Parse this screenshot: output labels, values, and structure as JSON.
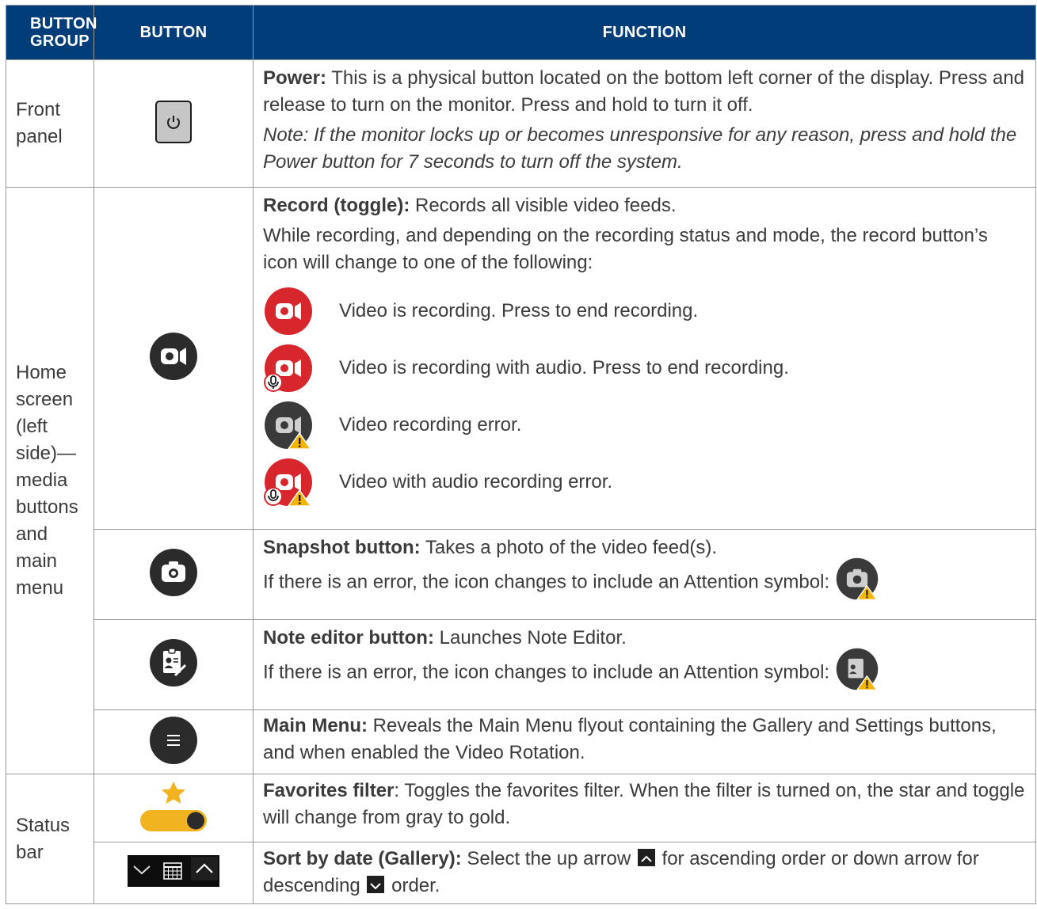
{
  "header": {
    "col1": "BUTTON GROUP",
    "col2": "BUTTON",
    "col3": "FUNCTION"
  },
  "rows": {
    "front_panel": {
      "group": "Front panel",
      "power_title": "Power:",
      "power_text": " This is a physical button located on the bottom left corner of the display. Press and release to turn on the monitor. Press and hold to turn it off.",
      "note": "Note: If the monitor locks up or becomes unresponsive for any reason, press and hold the Power button for 7 seconds to turn off the system."
    },
    "home_screen": {
      "group": "Home screen (left side)—media buttons and main menu",
      "record_title": "Record (toggle):",
      "record_text": " Records all visible video feeds.",
      "record_desc": "While recording, and depending on the recording status and mode, the record button’s icon will change to one of the following:",
      "states": [
        "Video is recording. Press to end recording.",
        "Video is recording with audio. Press to end recording.",
        "Video recording error.",
        "Video with audio recording error."
      ],
      "snapshot_title": "Snapshot button:",
      "snapshot_text": " Takes a photo of the video feed(s).",
      "snapshot_error": "If there is an error, the icon changes to include an Attention symbol:",
      "note_title": "Note editor button:",
      "note_text": " Launches Note Editor.",
      "note_error": "If there is an error, the icon changes to include an Attention symbol:",
      "menu_title": "Main Menu:",
      "menu_text": " Reveals the Main Menu flyout containing the Gallery and Settings buttons, and when enabled the Video Rotation."
    },
    "status_bar": {
      "group": "Status bar",
      "fav_title": "Favorites filter",
      "fav_text": ": Toggles the favorites filter. When the filter is turned on, the star and toggle will change from gray to gold.",
      "sort_title": "Sort by date (Gallery):",
      "sort_text1": " Select the up arrow ",
      "sort_text2": " for ascending order or down arrow for descending ",
      "sort_text3": " order."
    }
  },
  "colors": {
    "header_bg": "#003d79",
    "record_red": "#d8262d",
    "dark_icon": "#2b2b2b",
    "gold": "#f2b320",
    "warning": "#f5b400"
  },
  "icons": [
    "power-icon",
    "record-icon",
    "snapshot-icon",
    "note-editor-icon",
    "menu-icon",
    "favorites-toggle-icon",
    "sort-control-icon",
    "warning-icon",
    "mic-icon"
  ]
}
